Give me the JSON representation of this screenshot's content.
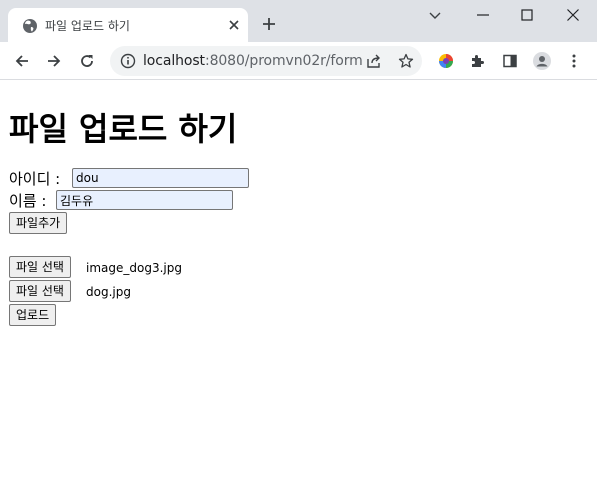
{
  "browser": {
    "tab_title": "파일 업로드 하기",
    "url_host": "localhost",
    "url_path": ":8080/promvn02r/form"
  },
  "page": {
    "title": "파일 업로드 하기",
    "id_label": "아이디 :",
    "id_value": "dou",
    "name_label": "이름 :",
    "name_value": "김두유",
    "add_file_button": "파일추가",
    "files": [
      {
        "button": "파일 선택",
        "filename": "image_dog3.jpg"
      },
      {
        "button": "파일 선택",
        "filename": "dog.jpg"
      }
    ],
    "upload_button": "업로드"
  }
}
